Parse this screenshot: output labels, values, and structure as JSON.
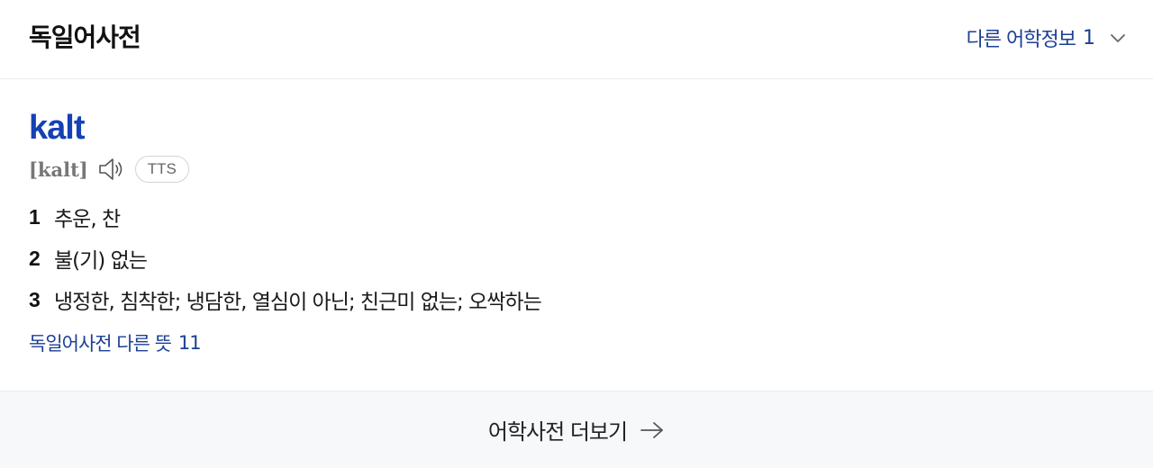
{
  "header": {
    "title": "독일어사전",
    "other_info_label": "다른 어학정보",
    "other_info_count": "1",
    "chevron_icon": "chevron-down-icon"
  },
  "entry": {
    "headword": "kalt",
    "pronunciation": "[kalt]",
    "speaker_icon": "speaker-icon",
    "tts_label": "TTS",
    "meanings": [
      {
        "num": "1",
        "text": "추운, 찬"
      },
      {
        "num": "2",
        "text": "불(기) 없는"
      },
      {
        "num": "3",
        "text": "냉정한, 침착한; 냉담한, 열심이 아닌; 친근미 없는; 오싹하는"
      }
    ],
    "more_senses_label": "독일어사전 다른 뜻",
    "more_senses_count": "11"
  },
  "footer": {
    "more_label": "어학사전 더보기",
    "arrow_icon": "arrow-right-icon"
  },
  "colors": {
    "headword": "#1541b3",
    "link": "#1c3f94",
    "footer_bg": "#f7f8fa"
  }
}
